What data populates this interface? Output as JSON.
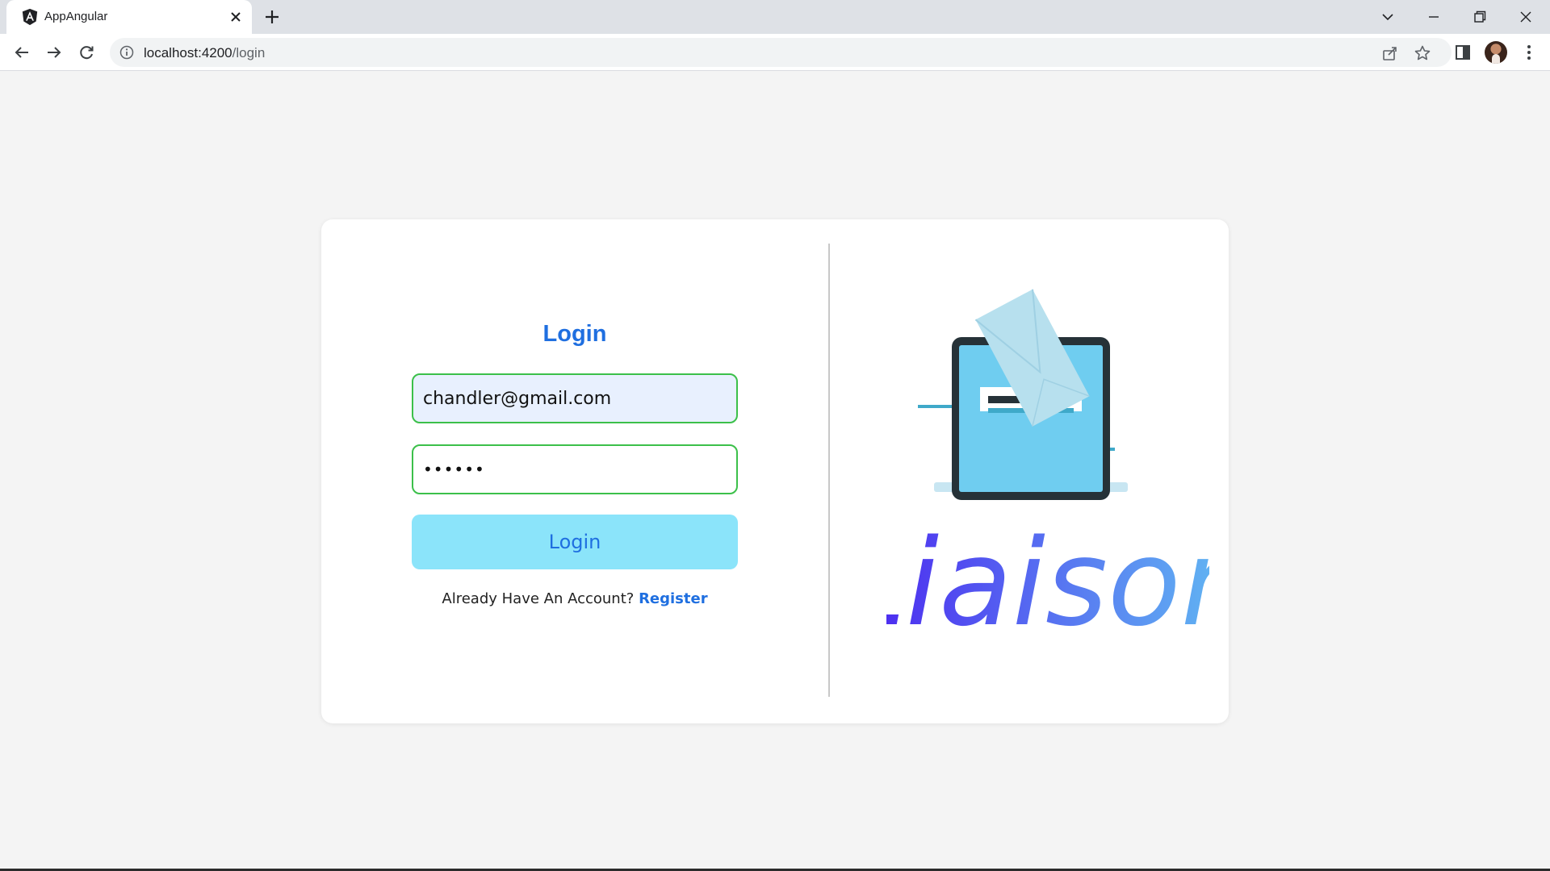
{
  "browser": {
    "tab_title": "AppAngular",
    "url_host": "localhost:4200",
    "url_path": "/login"
  },
  "login": {
    "title": "Login",
    "email_value": "chandler@gmail.com",
    "password_value": "••••••",
    "button_label": "Login",
    "account_prompt": "Already Have An Account?",
    "register_link": "Register"
  },
  "brand": {
    "name": "Liaison"
  },
  "colors": {
    "accent": "#1f6fe0",
    "button_bg": "#8be4fa",
    "valid_border": "#3cc04a",
    "brand_gradient_start": "#4a1df0",
    "brand_gradient_end": "#63c3f2"
  },
  "icons": [
    "angular-logo-icon",
    "close-icon",
    "plus-icon",
    "back-arrow-icon",
    "forward-arrow-icon",
    "reload-icon",
    "info-icon",
    "share-icon",
    "star-icon",
    "side-panel-icon",
    "kebab-menu-icon",
    "chevron-down-icon",
    "minimize-icon",
    "restore-icon"
  ]
}
